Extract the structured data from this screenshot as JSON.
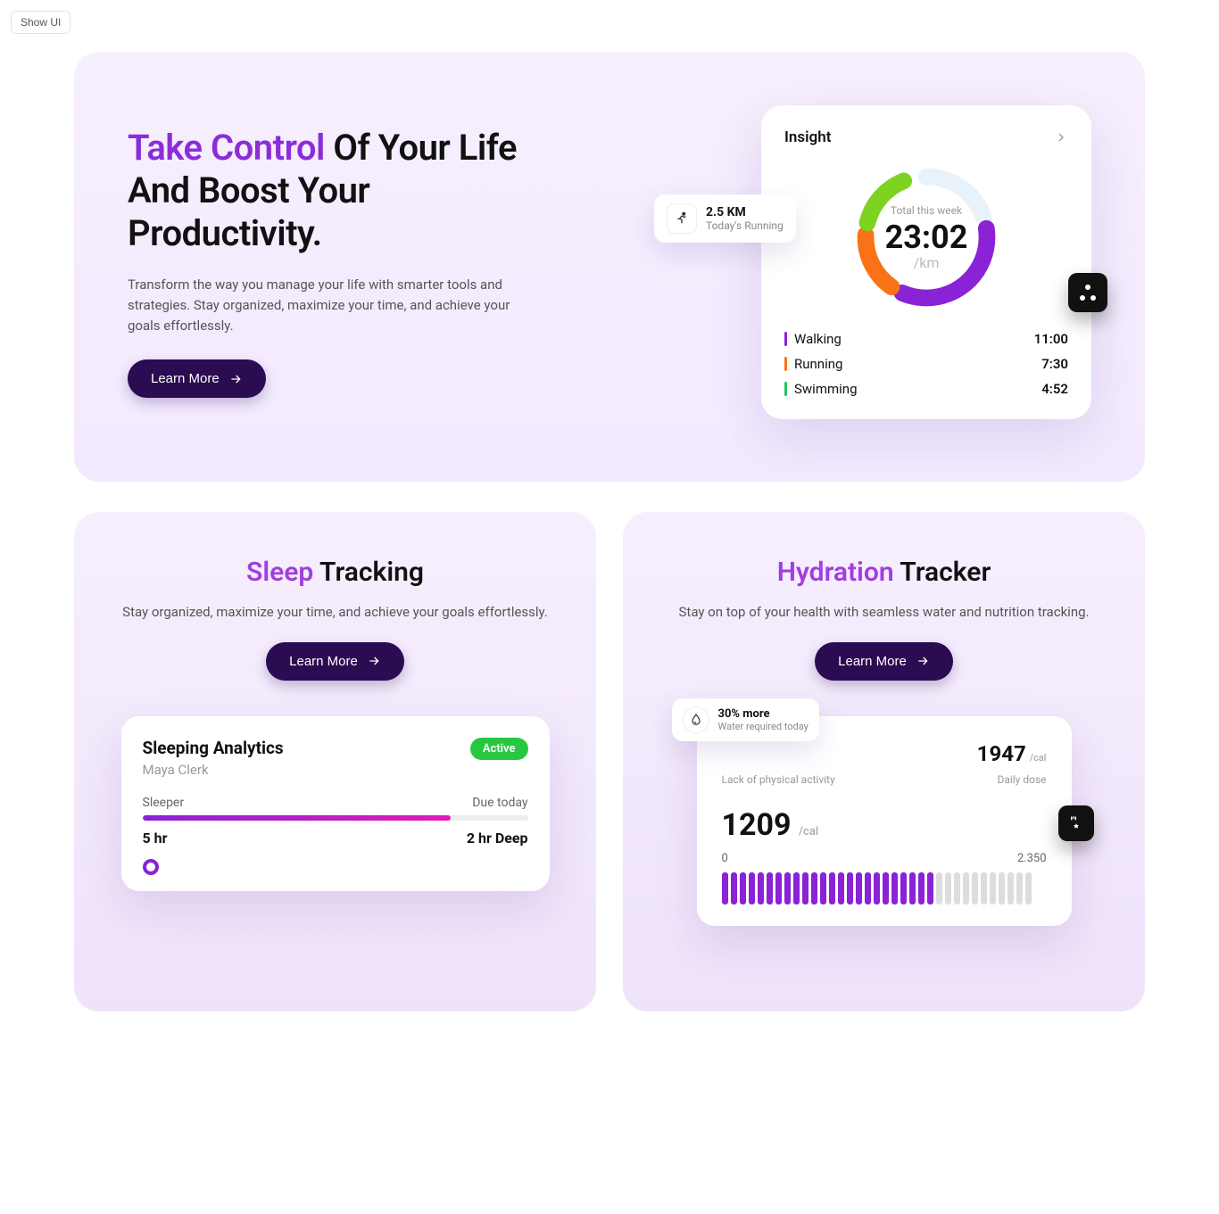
{
  "top": {
    "show_ui": "Show UI"
  },
  "hero": {
    "title_accent": "Take Control",
    "title_rest": " Of Your Life And Boost Your Productivity.",
    "subtitle": "Transform the way you manage your life with smarter tools and strategies. Stay organized, maximize your time, and achieve your goals effortlessly.",
    "cta": "Learn More",
    "insight": {
      "title": "Insight",
      "center_label": "Total this week",
      "center_value": "23:02",
      "center_unit": "/km",
      "legend": [
        {
          "name": "Walking",
          "value": "11:00",
          "color": "#8a22d6"
        },
        {
          "name": "Running",
          "value": "7:30",
          "color": "#f97316"
        },
        {
          "name": "Swimming",
          "value": "4:52",
          "color": "#22c55e"
        }
      ],
      "running_float": {
        "value": "2.5 KM",
        "label": "Today's Running"
      }
    }
  },
  "sleep": {
    "title_accent": "Sleep",
    "title_rest": " Tracking",
    "subtitle": "Stay organized, maximize your time, and achieve your goals effortlessly.",
    "cta": "Learn More",
    "card": {
      "heading": "Sleeping Analytics",
      "user": "Maya Clerk",
      "badge": "Active",
      "left_label": "Sleeper",
      "right_label": "Due today",
      "total": "5 hr",
      "deep": "2 hr Deep"
    }
  },
  "hydration": {
    "title_accent": "Hydration",
    "title_rest": " Tracker",
    "subtitle": "Stay on top of your health with seamless water and nutrition tracking.",
    "cta": "Learn More",
    "card": {
      "big_value": "1947",
      "big_unit": "/cal",
      "lack_label": "Lack of physical activity",
      "dose_label": "Daily dose",
      "current": "1209",
      "current_unit": "/cal",
      "range_min": "0",
      "range_max": "2.350",
      "bars_total": 35,
      "bars_filled": 24
    },
    "water_float": {
      "title": "30% more",
      "sub": "Water required today"
    }
  },
  "colors": {
    "purple": "#8a22d6",
    "orange": "#f97316",
    "green": "#7ed321",
    "teal": "#22c55e",
    "whiteblue": "#e8f2fb"
  },
  "chart_data": {
    "type": "pie",
    "title": "Total this week",
    "value_label": "23:02 /km",
    "series": [
      {
        "name": "Walking",
        "value": 660,
        "color": "#8a22d6"
      },
      {
        "name": "Running",
        "value": 450,
        "color": "#f97316"
      },
      {
        "name": "Swimming",
        "value": 292,
        "color": "#7ed321"
      }
    ],
    "total": 1382
  }
}
